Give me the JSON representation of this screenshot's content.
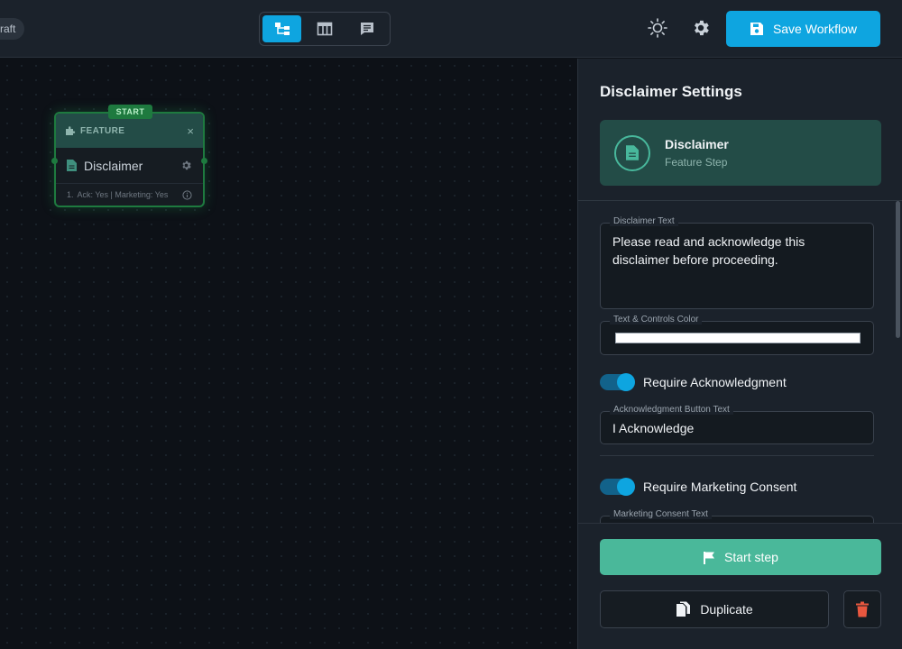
{
  "topbar": {
    "draft_label": "raft",
    "save_label": "Save Workflow"
  },
  "node": {
    "start_tag": "START",
    "type_label": "FEATURE",
    "close_glyph": "×",
    "title": "Disclaimer",
    "summary_index": "1.",
    "summary_text": "Ack: Yes | Marketing: Yes"
  },
  "panel": {
    "title": "Disclaimer Settings",
    "card": {
      "name": "Disclaimer",
      "subtitle": "Feature Step"
    },
    "fields": {
      "disclaimer_text": {
        "label": "Disclaimer Text",
        "value": "Please read and acknowledge this disclaimer before proceeding."
      },
      "color": {
        "label": "Text & Controls Color",
        "value": "#ffffff"
      },
      "require_ack": {
        "label": "Require Acknowledgment",
        "checked": true
      },
      "ack_button_text": {
        "label": "Acknowledgment Button Text",
        "value": "I Acknowledge"
      },
      "require_marketing": {
        "label": "Require Marketing Consent",
        "checked": true
      },
      "marketing_text": {
        "label": "Marketing Consent Text"
      }
    },
    "actions": {
      "start_step": "Start step",
      "duplicate": "Duplicate"
    }
  },
  "colors": {
    "accent": "#0ea5e0",
    "start_green": "#4ab89a",
    "delete_red": "#e8573f",
    "card_teal": "#234c47"
  }
}
